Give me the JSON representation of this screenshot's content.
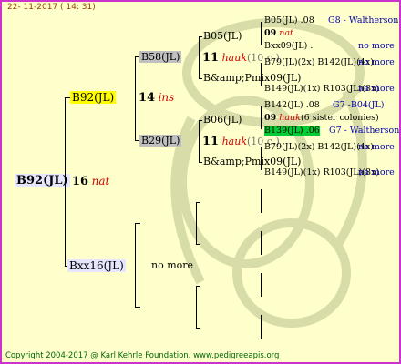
{
  "header": {
    "date": "22- 11-2017 ( 14: 31)"
  },
  "footer": {
    "copyright": "Copyright 2004-2017 @ Karl Kehrle Foundation.   www.pedigreeapis.org"
  },
  "root": {
    "name": "B92(JL)",
    "gen": "16",
    "gen_label": "nat"
  },
  "parents": {
    "dam": {
      "name": "B92(JL)",
      "gen": "14",
      "gen_label": "ins"
    },
    "sire": {
      "name": "Bxx16(JL)",
      "no_more": "no more"
    }
  },
  "grand": {
    "a": {
      "name": "B58(JL)",
      "gen": "11",
      "gen_label": "hauk",
      "gen_note": "(10 c.)"
    },
    "b": {
      "name": "B29(JL)",
      "gen": "11",
      "gen_label": "hauk",
      "gen_note": "(10 c.)"
    }
  },
  "ggp": {
    "a1": {
      "name": "B05(JL)"
    },
    "a2": {
      "name": "B&amp;Pmix09(JL)"
    },
    "b1": {
      "name": "B06(JL)"
    },
    "b2": {
      "name": "B&amp;Pmix09(JL)"
    }
  },
  "g4": {
    "r1": {
      "name": "B05(JL)",
      "year": ".08",
      "info": "G8 - Waltherson"
    },
    "r2": {
      "gen": "09",
      "gen_label": "nat"
    },
    "r3": {
      "name": "Bxx09(JL)",
      "year": ".",
      "info": "no more"
    },
    "r4": {
      "text": "B79(JL)(2x) B142(JL)(4x)",
      "info": "no more"
    },
    "r5": {
      "text": "B149(JL)(1x) R103(JL)(8x)",
      "info": "no more"
    },
    "r6": {
      "name": "B142(JL)",
      "year": ".08",
      "info": "G7 -B04(JL)"
    },
    "r7": {
      "gen": "09",
      "gen_label": "hauk",
      "note": "(6 sister colonies)"
    },
    "r8": {
      "name": "B139(JL)",
      "year": ".06",
      "info": "G7 - Waltherson"
    },
    "r9": {
      "text": "B79(JL)(2x) B142(JL)(4x)",
      "info": "no more"
    },
    "r10": {
      "text": "B149(JL)(1x) R103(JL)(8x)",
      "info": "no more"
    }
  },
  "colors": {
    "border": "#cc33cc",
    "background": "#ffffcc",
    "accent_red": "#d00000",
    "info_blue": "#0000aa",
    "highlight_green": "#00cc33"
  }
}
